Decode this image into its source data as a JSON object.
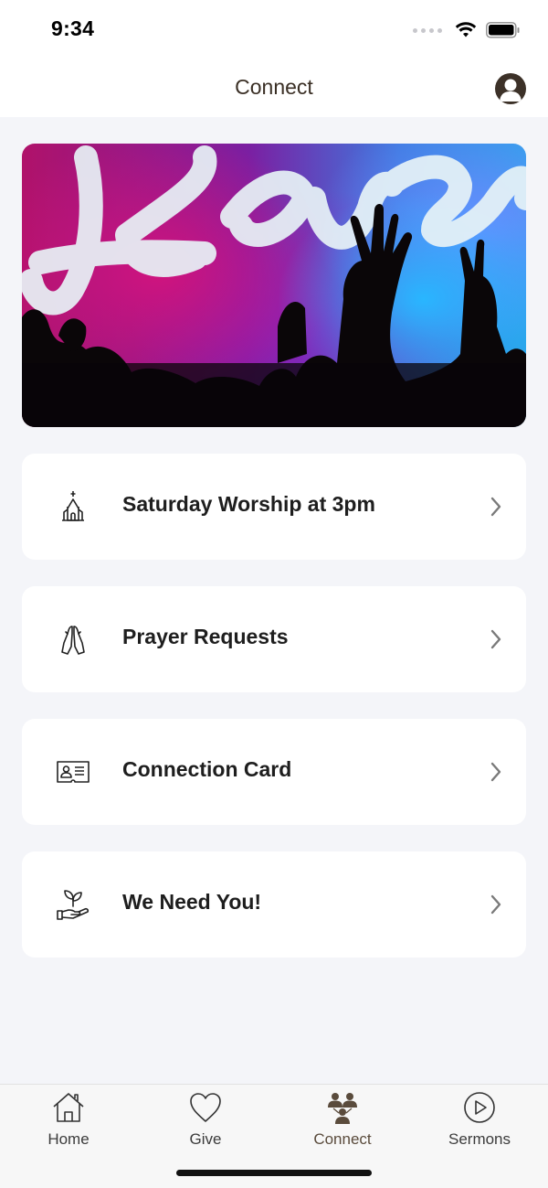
{
  "status_bar": {
    "time": "9:34"
  },
  "header": {
    "title": "Connect"
  },
  "hero": {
    "alt_icon": "worship-banner-image"
  },
  "menu": [
    {
      "label": "Saturday Worship at 3pm",
      "icon": "church-icon"
    },
    {
      "label": "Prayer Requests",
      "icon": "praying-hands-icon"
    },
    {
      "label": "Connection Card",
      "icon": "id-card-icon"
    },
    {
      "label": "We Need You!",
      "icon": "plant-hand-icon"
    }
  ],
  "tabs": [
    {
      "label": "Home",
      "icon": "home-icon",
      "active": false
    },
    {
      "label": "Give",
      "icon": "heart-icon",
      "active": false
    },
    {
      "label": "Connect",
      "icon": "people-icon",
      "active": true
    },
    {
      "label": "Sermons",
      "icon": "play-circle-icon",
      "active": false
    }
  ],
  "colors": {
    "accent": "#5a4b3c",
    "background": "#f4f5f9",
    "card": "#ffffff"
  }
}
